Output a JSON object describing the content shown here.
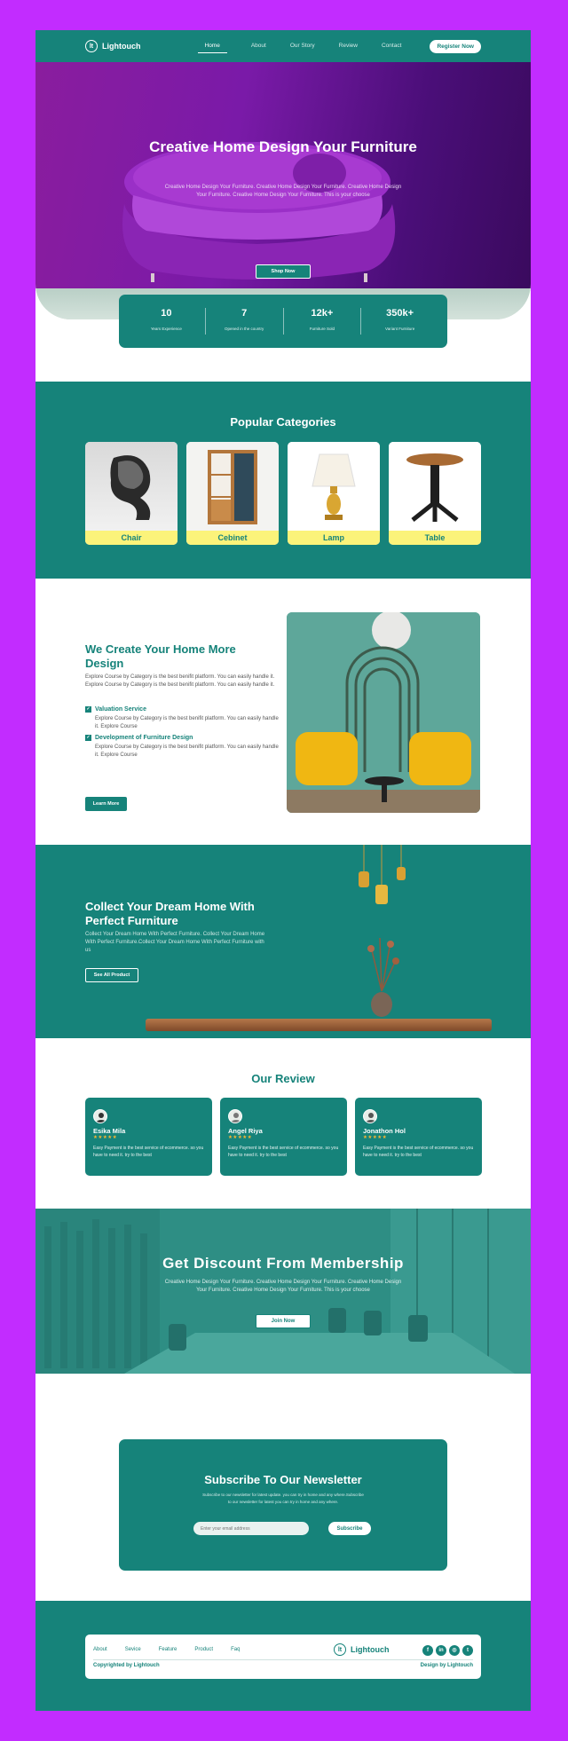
{
  "header": {
    "logo": "Lightouch",
    "logo_mark": "lt",
    "nav": [
      "Home",
      "About",
      "Our Story",
      "Review",
      "Contact"
    ],
    "register": "Register Now"
  },
  "hero": {
    "title": "Creative Home Design Your Furniture",
    "text": "Creative Home Design Your Furniture. Creative Home Design Your Furniture. Creative Home Design Your Furniture. Creative Home Design Your Furniture. This is your choose",
    "button": "Shop Now"
  },
  "stats": [
    {
      "value": "10",
      "label": "Years Experience"
    },
    {
      "value": "7",
      "label": "Opened in the country"
    },
    {
      "value": "12k+",
      "label": "Furniture Sold"
    },
    {
      "value": "350k+",
      "label": "Variant Furniture"
    }
  ],
  "categories": {
    "title": "Popular Categories",
    "items": [
      "Chair",
      "Cebinet",
      "Lamp",
      "Table"
    ]
  },
  "create": {
    "title": "We Create Your Home More Design",
    "text": "Explore Course by Category is the best benifit platform. You can easily handle it. Explore Course by Category is the best benifit platform. You can easily handle it.",
    "items": [
      {
        "title": "Valuation Service",
        "text": "Explore Course by Category is the best benifit platform. You can easily handle it. Explore Course"
      },
      {
        "title": "Development of Furniture Design",
        "text": "Explore Course by Category is the best benifit platform. You can easily handle it. Explore Course"
      }
    ],
    "button": "Learn More"
  },
  "collect": {
    "title": "Collect Your Dream Home With Perfect Furniture",
    "text": "Collect Your Dream Home With Perfect Furniture. Collect Your Dream Home With Perfect Furniture.Collect Your Dream Home With Perfect Furniture  with us",
    "button": "See All Product"
  },
  "review": {
    "title": "Our Review",
    "cards": [
      {
        "name": "Esika Mila",
        "stars": "★★★★★",
        "text": "Easy Payment is the best service of ecommerce. so you have to need it. try to the best"
      },
      {
        "name": "Angel Riya",
        "stars": "★★★★★",
        "text": "Easy Payment is the best service of ecommerce. so you have to need it. try to the best"
      },
      {
        "name": "Jonathon Hol",
        "stars": "★★★★★",
        "text": "Easy Payment is the best service of ecommerce. so you have to need it. try to the best"
      }
    ]
  },
  "membership": {
    "title": "Get Discount From Membership",
    "text": "Creative Home Design Your Furniture. Creative Home Design Your Furniture. Creative Home Design Your Furniture. Creative Home Design Your Furniture. This is your choose",
    "button": "Join Now"
  },
  "newsletter": {
    "title": "Subscribe To Our Newsletter",
    "text1": "Subscribe to our newsletter for latest update. you can try in home and any where.Subscribe",
    "text2": "to our newsletter for latest you can try in home and any where.",
    "placeholder": "Enter your email address",
    "button": "Subscribe"
  },
  "footer": {
    "links": [
      "About",
      "Sevice",
      "Feature",
      "Product",
      "Faq"
    ],
    "logo": "Lightouch",
    "logo_mark": "lt",
    "social": [
      "f",
      "in",
      "◎",
      "t"
    ],
    "social_icons": [
      "facebook-icon",
      "linkedin-icon",
      "instagram-icon",
      "twitter-icon"
    ],
    "copyright": "Copyrighted by Lightouch",
    "design": "Design by Lightouch"
  },
  "colors": {
    "brand": "#16837a",
    "accent": "#fbf37a",
    "page_bg": "#c22cff"
  }
}
